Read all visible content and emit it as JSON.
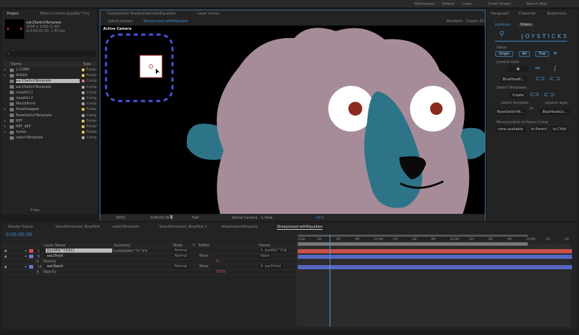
{
  "top_menu": [
    "Workspaces",
    "Default",
    "Learn",
    "Small Screen",
    "Search Help"
  ],
  "project_panel": {
    "tabs": [
      "Project",
      "Effect Controls [Joy$6&^Ch]"
    ],
    "selected_name": "ear2SwitchTemplate",
    "selected_info": [
      "1000 x 1000 (1.00)",
      "Δ 0;00;01;00, 1.40 fps"
    ],
    "search_placeholder": "",
    "columns": [
      "Name",
      "Type"
    ],
    "items": [
      {
        "name": "1.COMP",
        "type": "Folder",
        "color": "#d8c24a",
        "folder": true
      },
      {
        "name": "AUDIO",
        "type": "Folder",
        "color": "#d8c24a",
        "folder": true
      },
      {
        "name": "ear2SwitchTemplate",
        "type": "Comp",
        "color": "#d070b0",
        "folder": false,
        "selected": true
      },
      {
        "name": "ear1SwitchTemplate",
        "type": "Comp",
        "color": "#aaa",
        "folder": false
      },
      {
        "name": "mouthU.1",
        "type": "Comp",
        "color": "#aaa",
        "folder": false
      },
      {
        "name": "mouthU.2",
        "type": "Comp",
        "color": "#aaa",
        "folder": false
      },
      {
        "name": "MouthFront",
        "type": "Comp",
        "color": "#aaa",
        "folder": false
      },
      {
        "name": "NoseSwapper",
        "type": "Folder",
        "color": "#d8c24a",
        "folder": true
      },
      {
        "name": "NoseSwitchTemplate",
        "type": "Comp",
        "color": "#aaa",
        "folder": false
      },
      {
        "name": "REF",
        "type": "Folder",
        "color": "#d8c24a",
        "folder": true
      },
      {
        "name": "REF_AEP",
        "type": "Folder",
        "color": "#d8c24a",
        "folder": true
      },
      {
        "name": "Solids",
        "type": "Folder",
        "color": "#d8c24a",
        "folder": true
      },
      {
        "name": "switchTemplate",
        "type": "Comp",
        "color": "#aaa",
        "folder": false
      }
    ],
    "bpc": "8 bpc"
  },
  "viewer": {
    "tabs": [
      "Composition Sheepnosed withEqualizer",
      "Layer (none)"
    ],
    "subtabs": [
      "JoinyCompact",
      "Sheepnosed withEqualize"
    ],
    "renderer": "Renderer:",
    "renderer_value": "Classic 3D",
    "camera_label": "Active Camera",
    "footer": {
      "zoom": "100%",
      "time": "0;00;00;26",
      "resolution": "Half",
      "camera": "Active Camera",
      "views": "1 View",
      "exposure": "+0.0"
    }
  },
  "right_panel": {
    "tabs": [
      "Paragraph",
      "Character",
      "Bodymovin"
    ],
    "subtabs": [
      "Joysticks",
      "Sliders"
    ],
    "title": "JOYSTICKS",
    "setup_label": "Setup",
    "origin": "Origin",
    "all": "All",
    "flat": "Flat",
    "tools_label": "Joystick tools",
    "joystick_select": "BlueHeadC...",
    "switch_label": "Switch Templates",
    "create": "Create",
    "switch_template_label": "switch template",
    "joystick_layer_label": "joystick layer",
    "to": "to",
    "switch_template_value": "NoseSwitchTe...",
    "joystick_layer_value": "BlueHeadCo...",
    "move_label": "Move Joystick to Parent Comp",
    "none_available": "none available",
    "to_parent": "to Parent",
    "to_child": "to Child"
  },
  "timeline": {
    "tabs": [
      "Render Queue",
      "Stand3Inversed_NoseTest",
      "switchTemplate",
      "Stand3Inversed_NoseTest 2",
      "NoseSwitchTemplate",
      "Sheepnosed withEqualizer"
    ],
    "timecode": "0:00:00:26",
    "columns": [
      "Layer Name",
      "Summary",
      "Mode",
      "T",
      "TrkMat",
      "Parent"
    ],
    "layers": [
      {
        "num": "1",
        "name": "[Joy$6&^Ch$1]",
        "summary": "Joy$6&$6&^%^$%",
        "mode": "Normal",
        "trkmat": "",
        "parent": "3. Joy$6&^Ch$",
        "color": "#d9534f",
        "selected": true
      },
      {
        "num": "9",
        "name": "ear2front",
        "summary": "",
        "mode": "Normal",
        "trkmat": "None",
        "parent": "None",
        "color": "#6a7bd8"
      },
      {
        "num": "",
        "name": "Opacity",
        "summary": "",
        "mode": "",
        "trkmat": "",
        "parent": "",
        "value": "%",
        "prop": true
      },
      {
        "num": "14",
        "name": "ear2back",
        "summary": "",
        "mode": "Normal",
        "trkmat": "None",
        "parent": "4. ear1front",
        "color": "#6a7bd8"
      },
      {
        "num": "",
        "name": "Opacity",
        "summary": "",
        "mode": "",
        "trkmat": "",
        "parent": "",
        "value": "100%",
        "prop": true
      }
    ],
    "ruler": [
      "0:00f",
      "10f",
      "20f",
      "00f",
      "01:00f",
      "10f",
      "20f",
      "00f",
      "02:00f",
      "10f",
      "20f",
      "00f",
      "03:00f",
      "10f",
      "20f"
    ],
    "track_colors": [
      "#c9504a",
      "#5667c4",
      "",
      "#5667c4",
      ""
    ]
  },
  "colors": {
    "accent": "#3d8bd6",
    "face": "#a68c99",
    "teal": "#2d7488",
    "pupil": "#8b2a1e",
    "dash": "#4a55e0"
  }
}
